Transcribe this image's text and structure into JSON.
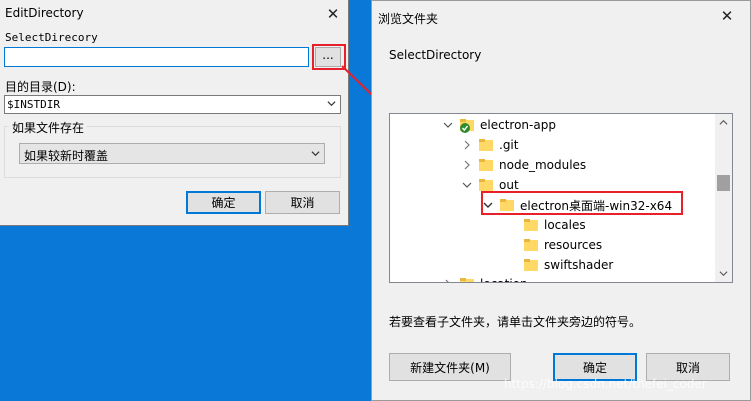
{
  "left_dialog": {
    "title": "EditDirectory",
    "close": "✕",
    "select_label": "SelectDirecory",
    "browse_button": "...",
    "dest_label": "目的目录(D):",
    "dest_value": "$INSTDIR",
    "group_label": "如果文件存在",
    "overwrite_value": "如果较新时覆盖",
    "ok": "确定",
    "cancel": "取消"
  },
  "right_dialog": {
    "title": "浏览文件夹",
    "close": "✕",
    "heading": "SelectDirectory",
    "hint": "若要查看子文件夹，请单击文件夹旁边的符号。",
    "new_folder": "新建文件夹(M)",
    "ok": "确定",
    "cancel": "取消",
    "tree": [
      {
        "label": "electron-app",
        "expanded": true
      },
      {
        "label": ".git",
        "expanded": false
      },
      {
        "label": "node_modules",
        "expanded": false
      },
      {
        "label": "out",
        "expanded": true
      },
      {
        "label": "electron桌面端-win32-x64",
        "expanded": true
      },
      {
        "label": "locales"
      },
      {
        "label": "resources"
      },
      {
        "label": "swiftshader"
      },
      {
        "label": "location"
      }
    ]
  },
  "watermark": "https://blog.csdn.net/thefei_coder",
  "colors": {
    "highlight": "#e8202a",
    "accent": "#0078d7",
    "desktop": "#0a78d7",
    "folder": "#ffd866"
  }
}
